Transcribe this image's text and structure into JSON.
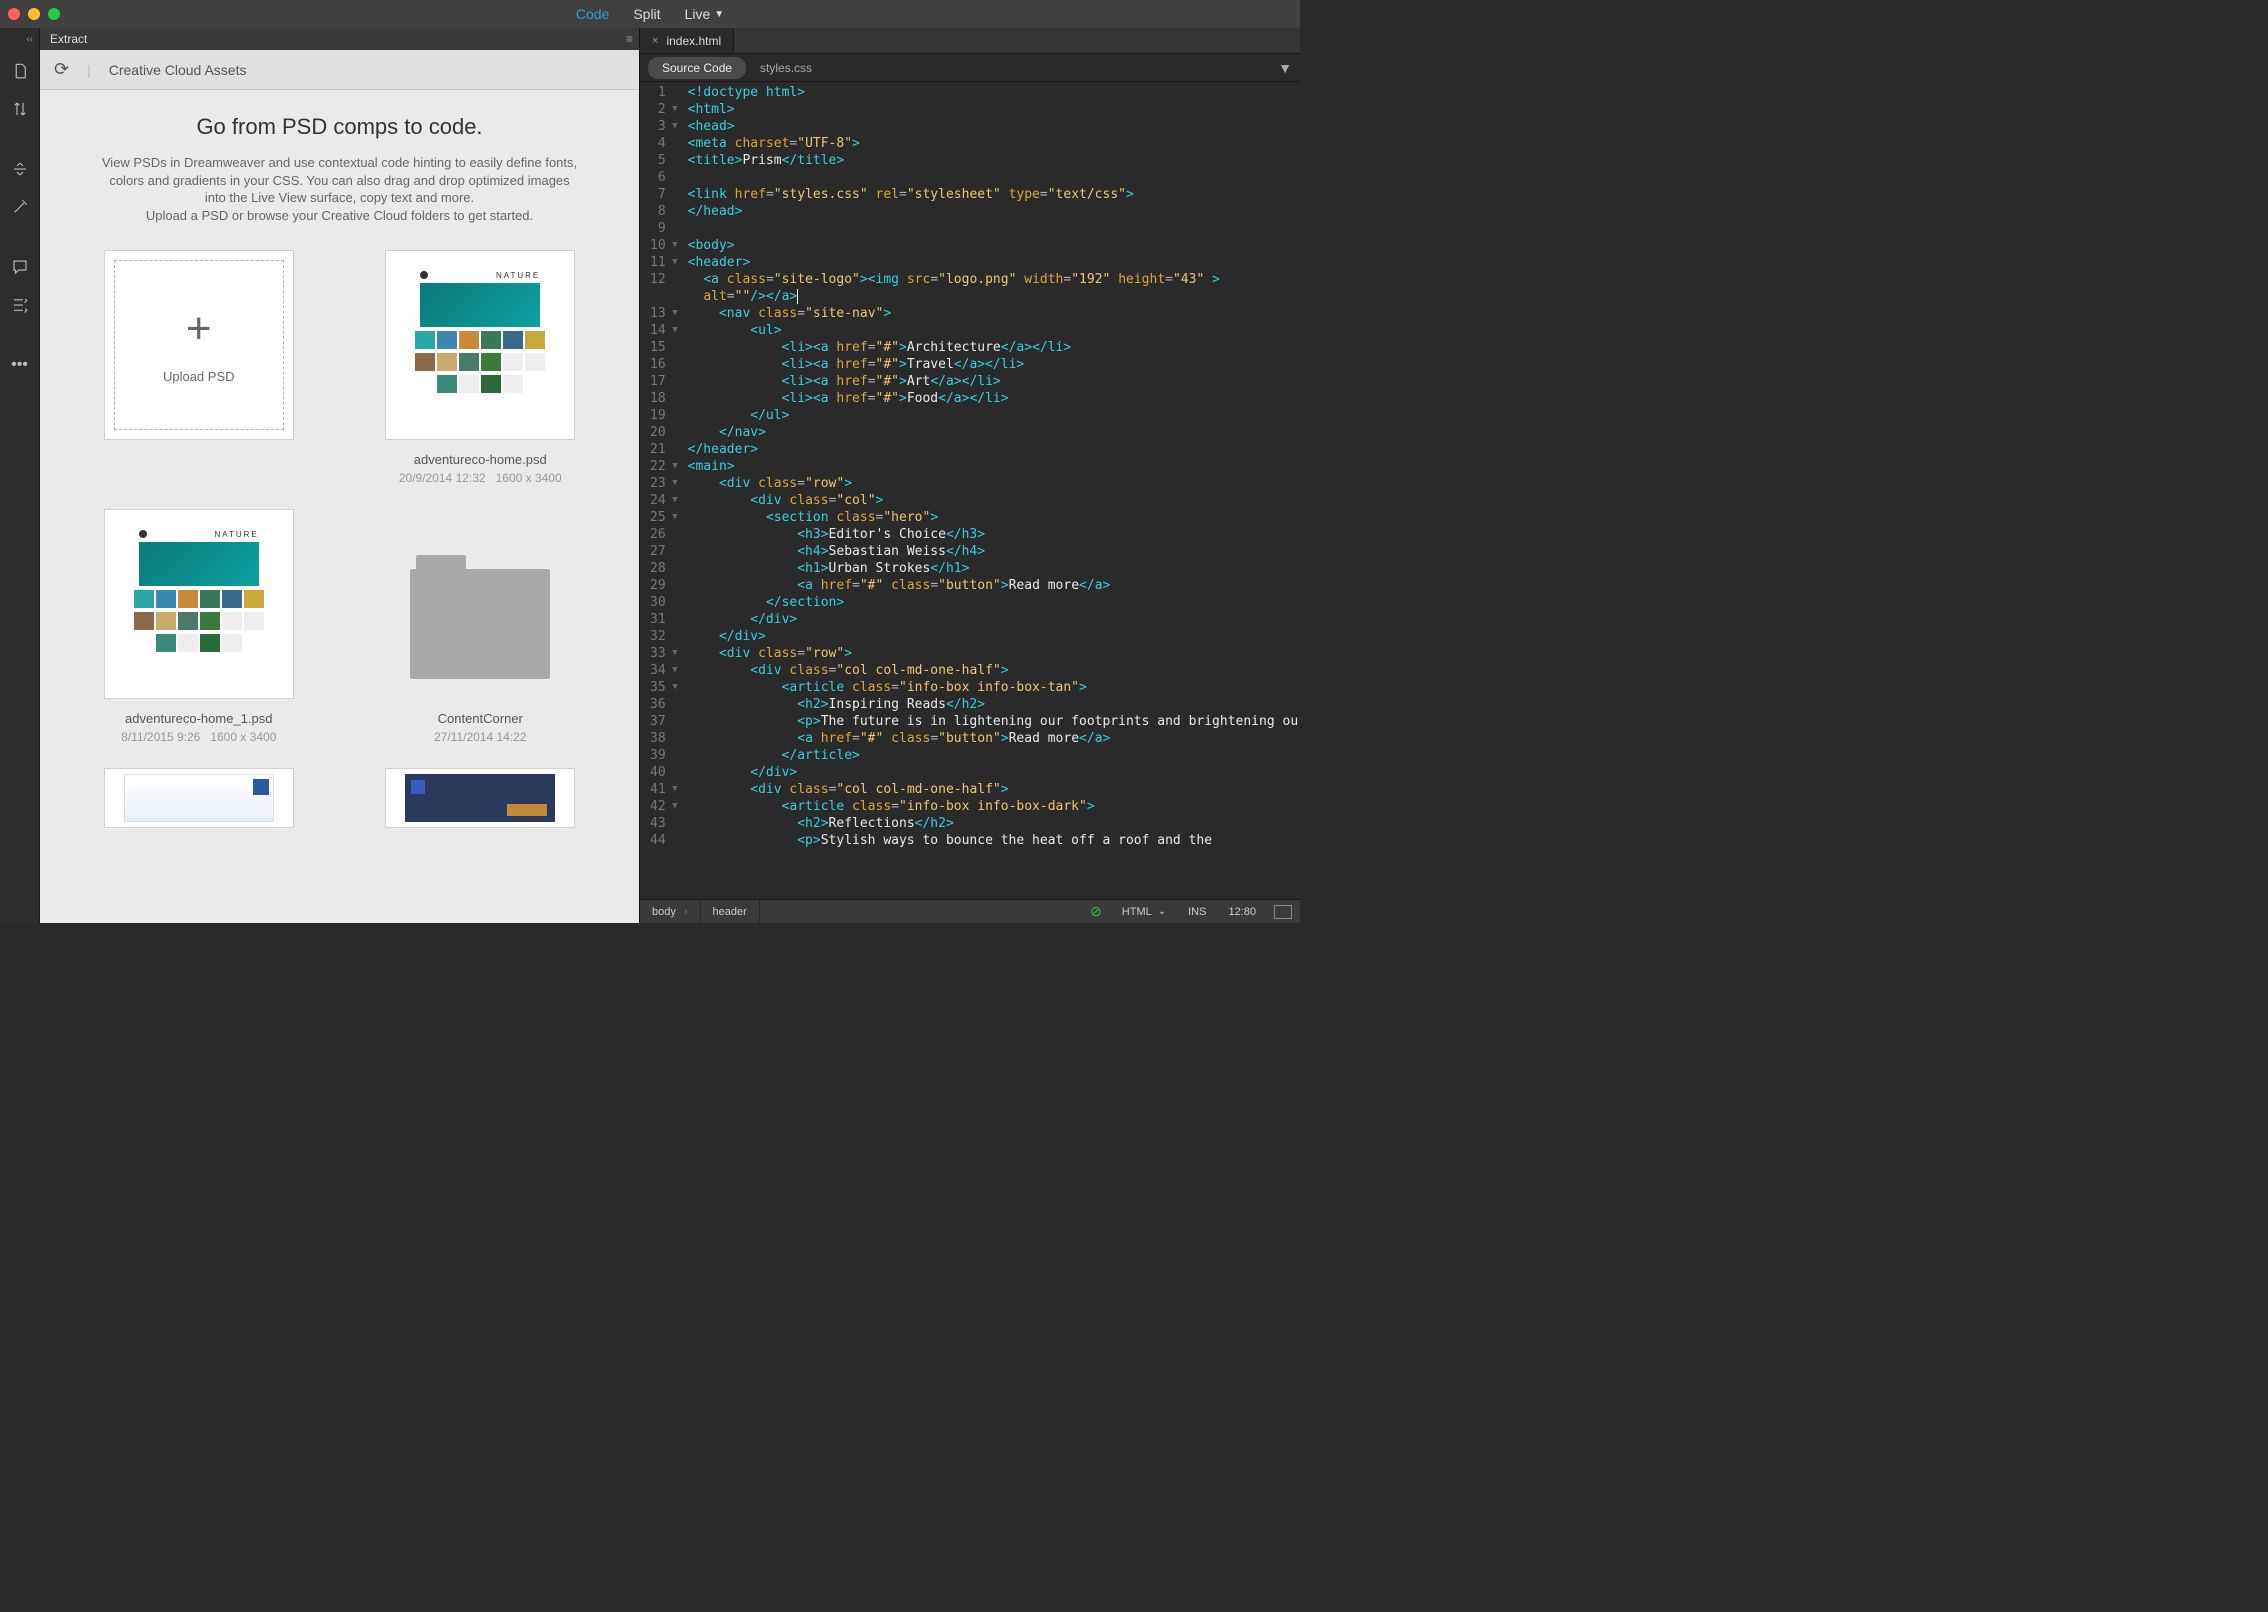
{
  "viewModes": {
    "code": "Code",
    "split": "Split",
    "live": "Live"
  },
  "extract": {
    "panel": "Extract",
    "cc": "Creative Cloud Assets",
    "title": "Go from PSD comps to code.",
    "desc1": "View PSDs in Dreamweaver and use contextual code hinting to easily define fonts, colors and gradients in your CSS. You can also drag and drop optimized images into the Live View surface, copy text and more.",
    "desc2": "Upload a PSD or browse your Creative Cloud folders to get started.",
    "uploadLabel": "Upload PSD",
    "items": [
      {
        "name": "adventureco-home.psd",
        "date": "20/9/2014 12:32",
        "dims": "1600 x 3400"
      },
      {
        "name": "adventureco-home_1.psd",
        "date": "8/11/2015 9:26",
        "dims": "1600 x 3400"
      },
      {
        "name": "ContentCorner",
        "date": "27/11/2014 14:22",
        "dims": ""
      }
    ]
  },
  "fileTab": "index.html",
  "sourceTabs": {
    "source": "Source Code",
    "styles": "styles.css"
  },
  "code": {
    "doctype": "<!doctype html>",
    "metaCharset": "UTF-8",
    "title": "Prism",
    "linkHref": "styles.css",
    "linkRel": "stylesheet",
    "linkType": "text/css",
    "logoSrc": "logo.png",
    "logoW": "192",
    "logoH": "43",
    "logoAlt": "",
    "siteLogoClass": "site-logo",
    "siteNavClass": "site-nav",
    "hrefHash": "#",
    "nav": {
      "arch": "Architecture",
      "travel": "Travel",
      "art": "Art",
      "food": "Food"
    },
    "rowClass": "row",
    "colClass": "col",
    "colHalf": "col col-md-one-half",
    "heroClass": "hero",
    "buttonClass": "button",
    "infoTan": "info-box info-box-tan",
    "infoDark": "info-box info-box-dark",
    "h3": "Editor's Choice",
    "h4": "Sebastian Weiss",
    "h1": "Urban Strokes",
    "readMore": "Read more",
    "h2a": "Inspiring Reads",
    "pA": "The future is in lightening our footprints and brightening our lives.",
    "h2b": "Reflections",
    "pB": "Stylish ways to bounce the heat off a roof and the"
  },
  "status": {
    "crumb1": "body",
    "crumb2": "header",
    "lang": "HTML",
    "ins": "INS",
    "pos": "12:80"
  }
}
